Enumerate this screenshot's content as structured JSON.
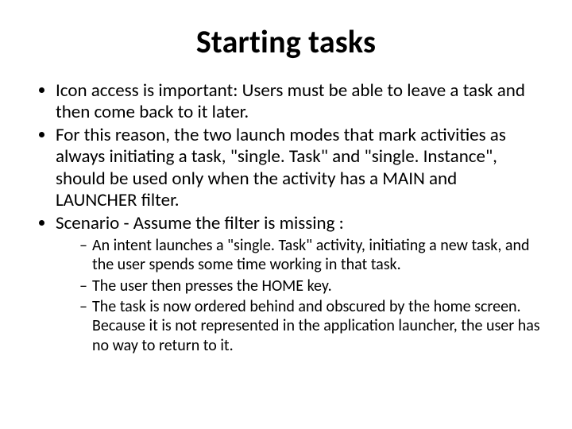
{
  "title": "Starting tasks",
  "bullets": {
    "b1": "Icon access is important: Users must be able to leave a task and then come back to it later.",
    "b2": "For this reason, the two launch modes that mark activities as always initiating a task, \"single. Task\" and \"single. Instance\", should be used only when the activity has a MAIN and LAUNCHER filter.",
    "b3": "Scenario - Assume the filter is missing :",
    "sub": {
      "s1": "An intent launches a \"single. Task\" activity, initiating a new task, and the user spends some time working in that task.",
      "s2": "The user then presses the HOME key.",
      "s3": "The task is now ordered behind and obscured by the home screen. Because it is not represented in the application launcher, the user has no way to return to it."
    }
  }
}
